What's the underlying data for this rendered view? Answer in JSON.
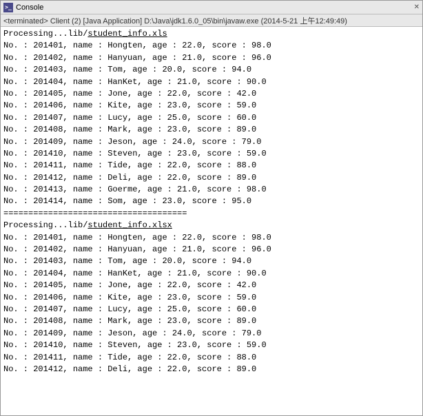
{
  "window": {
    "title": "Console",
    "close_symbol": "✕",
    "tab_label": "Console"
  },
  "status_bar": {
    "text": "<terminated> Client (2) [Java Application] D:\\Java\\jdk1.6.0_05\\bin\\javaw.exe (2014-5-21 上午12:49:49)"
  },
  "sections": [
    {
      "processing_label": "Processing...lib/",
      "processing_file": "student_info.xls",
      "records": [
        "No. : 201401, name : Hongten, age : 22.0, score : 98.0",
        "No. : 201402, name : Hanyuan, age : 21.0, score : 96.0",
        "No. : 201403, name : Tom, age : 20.0, score : 94.0",
        "No. : 201404, name : HanKet, age : 21.0, score : 90.0",
        "No. : 201405, name : Jone, age : 22.0, score : 42.0",
        "No. : 201406, name : Kite, age : 23.0, score : 59.0",
        "No. : 201407, name : Lucy, age : 25.0, score : 60.0",
        "No. : 201408, name : Mark, age : 23.0, score : 89.0",
        "No. : 201409, name : Jeson, age : 24.0, score : 79.0",
        "No. : 201410, name : Steven, age : 23.0, score : 59.0",
        "No. : 201411, name : Tide, age : 22.0, score : 88.0",
        "No. : 201412, name : Deli, age : 22.0, score : 89.0",
        "No. : 201413, name : Goerme, age : 21.0, score : 98.0",
        "No. : 201414, name : Som, age : 23.0, score : 95.0"
      ],
      "separator": "====================================="
    },
    {
      "processing_label": "Processing...lib/",
      "processing_file": "student_info.xlsx",
      "records": [
        "No. : 201401, name : Hongten, age : 22.0, score : 98.0",
        "No. : 201402, name : Hanyuan, age : 21.0, score : 96.0",
        "No. : 201403, name : Tom, age : 20.0, score : 94.0",
        "No. : 201404, name : HanKet, age : 21.0, score : 90.0",
        "No. : 201405, name : Jone, age : 22.0, score : 42.0",
        "No. : 201406, name : Kite, age : 23.0, score : 59.0",
        "No. : 201407, name : Lucy, age : 25.0, score : 60.0",
        "No. : 201408, name : Mark, age : 23.0, score : 89.0",
        "No. : 201409, name : Jeson, age : 24.0, score : 79.0",
        "No. : 201410, name : Steven, age : 23.0, score : 59.0",
        "No. : 201411, name : Tide, age : 22.0, score : 88.0",
        "No. : 201412, name : Deli, age : 22.0, score : 89.0"
      ]
    }
  ]
}
